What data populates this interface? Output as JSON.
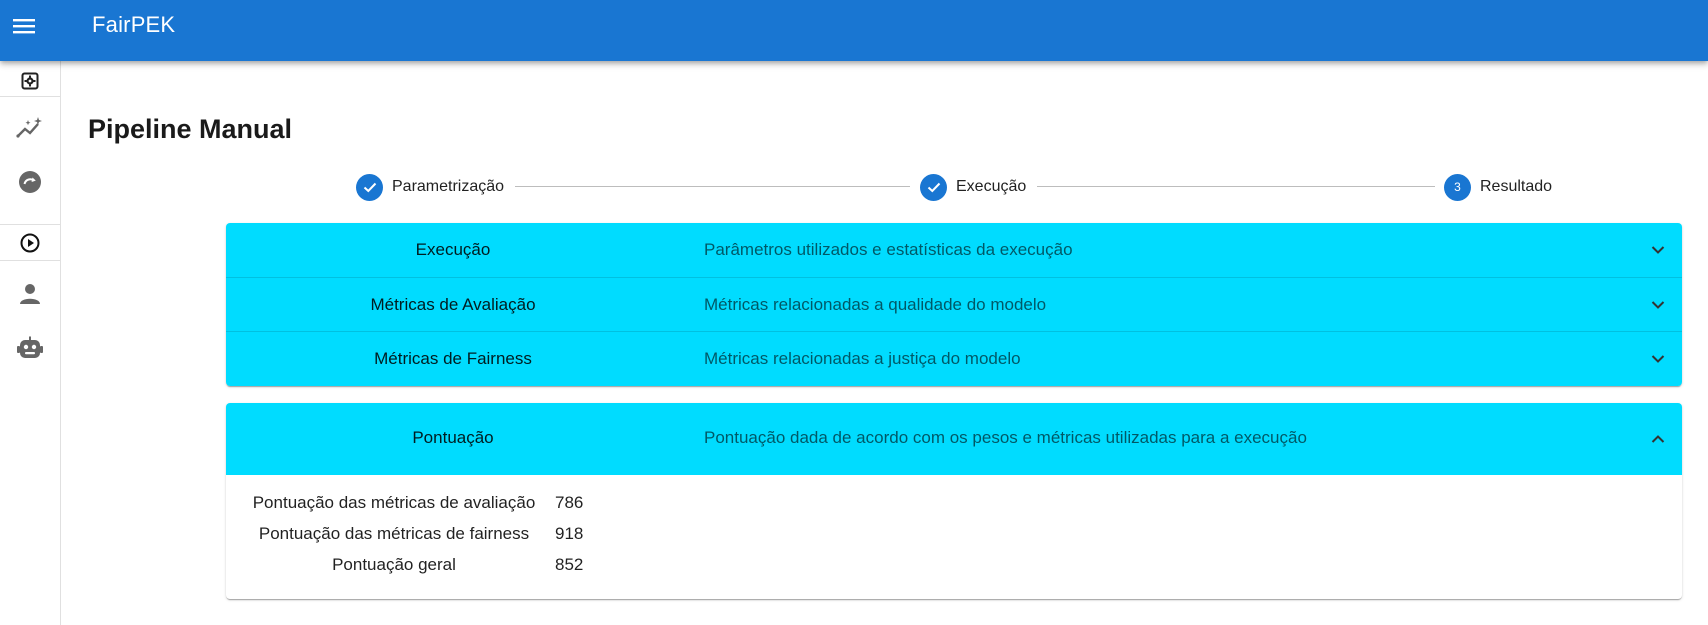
{
  "app": {
    "title": "FairPEK"
  },
  "page": {
    "title": "Pipeline Manual"
  },
  "drawer": {
    "items": [
      {
        "icon": "settings-icon"
      },
      {
        "icon": "chart-sparkle-icon"
      },
      {
        "icon": "refresh-circle-icon"
      },
      {
        "icon": "play-circle-icon"
      },
      {
        "icon": "person-icon"
      },
      {
        "icon": "robot-icon"
      }
    ]
  },
  "stepper": {
    "steps": [
      {
        "label": "Parametrização",
        "state": "completed"
      },
      {
        "label": "Execução",
        "state": "completed"
      },
      {
        "label": "Resultado",
        "state": "active",
        "number": "3"
      }
    ]
  },
  "accordion": {
    "panels": [
      {
        "title": "Execução",
        "subtitle": "Parâmetros utilizados e estatísticas da execução",
        "expanded": false
      },
      {
        "title": "Métricas de Avaliação",
        "subtitle": "Métricas relacionadas a qualidade do modelo",
        "expanded": false
      },
      {
        "title": "Métricas de Fairness",
        "subtitle": "Métricas relacionadas a justiça do modelo",
        "expanded": false
      }
    ],
    "score_panel": {
      "title": "Pontuação",
      "subtitle": "Pontuação dada de acordo com os pesos e métricas utilizadas para a execução",
      "expanded": true,
      "rows": [
        {
          "label": "Pontuação das métricas de avaliação",
          "value": "786"
        },
        {
          "label": "Pontuação das métricas de fairness",
          "value": "918"
        },
        {
          "label": "Pontuação geral",
          "value": "852"
        }
      ]
    }
  },
  "colors": {
    "primary": "#1976d2",
    "panel": "#00dcff"
  }
}
